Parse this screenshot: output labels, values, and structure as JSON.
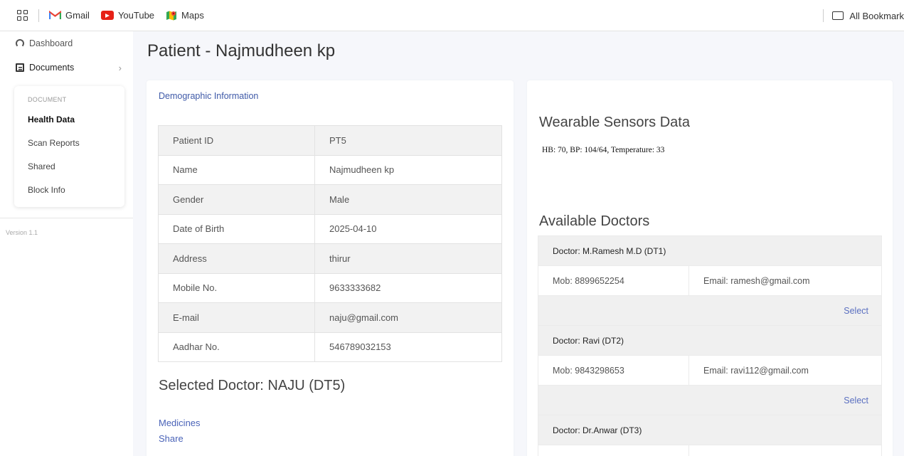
{
  "bookmarks": {
    "items": [
      {
        "label": "Gmail",
        "icon": "gmail-icon"
      },
      {
        "label": "YouTube",
        "icon": "youtube-icon"
      },
      {
        "label": "Maps",
        "icon": "maps-icon"
      }
    ],
    "all_bookmarks": "All Bookmark"
  },
  "sidebar": {
    "dashboard": "Dashboard",
    "documents": "Documents",
    "chevron": "›",
    "section": "DOCUMENT",
    "items": [
      "Health Data",
      "Scan Reports",
      "Shared",
      "Block Info"
    ],
    "version": "Version 1.1"
  },
  "page": {
    "title": "Patient - Najmudheen kp"
  },
  "demographics": {
    "title": "Demographic Information",
    "rows": [
      {
        "label": "Patient ID",
        "value": "PT5"
      },
      {
        "label": "Name",
        "value": "Najmudheen kp"
      },
      {
        "label": "Gender",
        "value": "Male"
      },
      {
        "label": "Date of Birth",
        "value": "2025-04-10"
      },
      {
        "label": "Address",
        "value": "thirur"
      },
      {
        "label": "Mobile No.",
        "value": "9633333682"
      },
      {
        "label": "E-mail",
        "value": "naju@gmail.com"
      },
      {
        "label": "Aadhar No.",
        "value": "546789032153"
      }
    ],
    "selected_doctor": "Selected Doctor: NAJU (DT5)",
    "medicines": "Medicines",
    "share": "Share"
  },
  "sensors": {
    "title": "Wearable Sensors Data",
    "data": "HB: 70, BP: 104/64, Temperature: 33"
  },
  "doctors": {
    "title": "Available Doctors",
    "select_label": "Select",
    "list": [
      {
        "name": "Doctor: M.Ramesh M.D (DT1)",
        "mob": "Mob: 8899652254",
        "email": "Email: ramesh@gmail.com"
      },
      {
        "name": "Doctor: Ravi (DT2)",
        "mob": "Mob: 9843298653",
        "email": "Email: ravi112@gmail.com"
      },
      {
        "name": "Doctor: Dr.Anwar (DT3)",
        "mob": "",
        "email": ""
      }
    ]
  },
  "colors": {
    "link": "#4a63b8",
    "accent_title": "#3f5aa8"
  }
}
